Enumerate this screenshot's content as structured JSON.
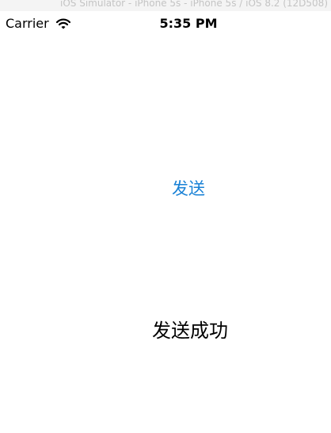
{
  "simulator": {
    "title": "iOS Simulator - iPhone 5s - iPhone 5s / iOS 8.2 (12D508)"
  },
  "status_bar": {
    "carrier": "Carrier",
    "wifi_icon": "wifi-icon",
    "time": "5:35 PM"
  },
  "main": {
    "send_label": "发送",
    "result_text": "发送成功",
    "accent_color": "#1a82d6"
  }
}
